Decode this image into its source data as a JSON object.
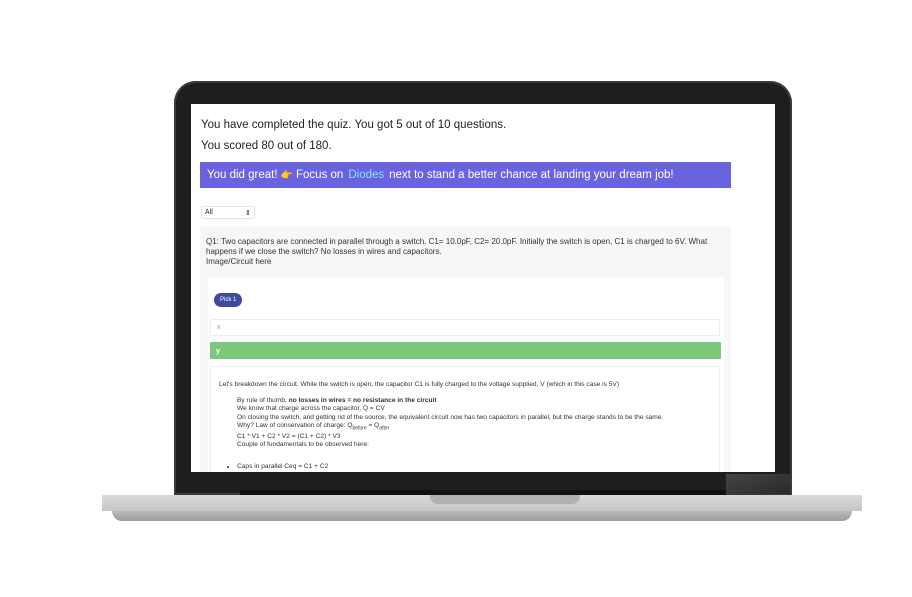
{
  "quiz": {
    "completed_text": "You have completed the quiz. You got 5 out of 10 questions.",
    "score_text": "You scored 80 out of 180.",
    "banner": {
      "prefix": "You did great!",
      "emoji": "👉",
      "focus_label": "Focus on",
      "topic_link": "Diodes",
      "suffix": "next to stand a better chance at landing your dream job!",
      "bg_color": "#6a63df"
    },
    "filter": {
      "selected": "All"
    },
    "question": {
      "text": "Q1: Two capacitors are connected in parallel through a switch. C1= 10.0pF, C2= 20.0pF. Initially the switch is open, C1 is charged to 6V. What happens if we close the switch? No losses in wires and capacitors.",
      "image_placeholder": "Image/Circuit here",
      "pick_badge": "Pick 1",
      "options": [
        {
          "label": "x",
          "correct": false
        },
        {
          "label": "y",
          "correct": true,
          "color": "#7dc87a"
        }
      ]
    },
    "explanation": {
      "intro": "Let's breakdown the circuit. While the switch is open, the capacitor C1 is fully charged to the voltage supplied, V (which in this case is 5V)",
      "rule_prefix": "By rule of thumb, ",
      "rule_bold": "no losses in wires = no resistance in the circuit",
      "line_charge": "We know that charge across the capacitor, Q = CV",
      "line_switch": "On closing the switch, and getting rid of the source, the equivalent circuit now has two capacitors in parallel, but the charge stands to be the same.",
      "why_prefix": "Why? Law of conservation of charge: Q",
      "why_before": "before",
      "why_eq": " = Q",
      "why_after": "after",
      "equation": "C1 * V1 + C2 * V2 = (C1 + C2) * V3",
      "fundamentals": "Couple of fundamentals to be observed here:",
      "bullets": [
        "Caps in parallel Ceq = C1 + C2"
      ]
    }
  }
}
